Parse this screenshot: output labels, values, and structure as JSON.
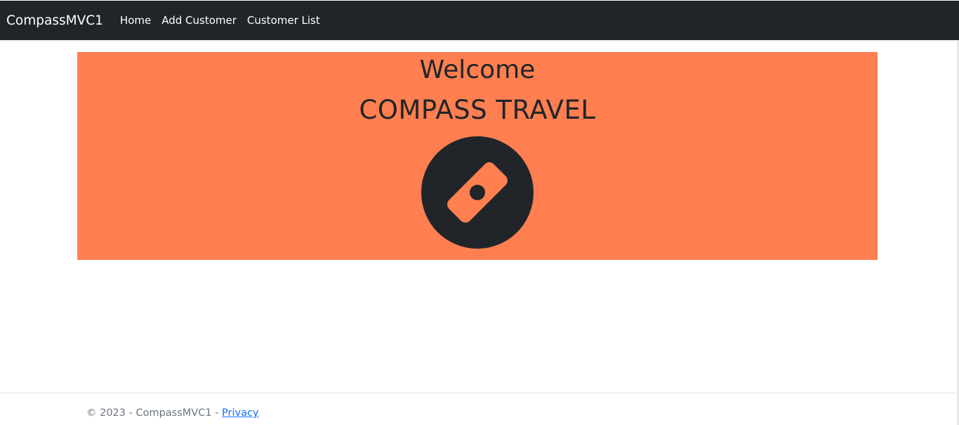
{
  "navbar": {
    "brand": "CompassMVC1",
    "links": [
      "Home",
      "Add Customer",
      "Customer List"
    ]
  },
  "hero": {
    "welcome": "Welcome",
    "title": "COMPASS TRAVEL",
    "icon": "compass-icon",
    "background_color": "#ff7f50"
  },
  "footer": {
    "text": "© 2023 - CompassMVC1 - ",
    "privacy_link": "Privacy"
  },
  "colors": {
    "navbar_bg": "#212529",
    "link": "#0d6efd"
  }
}
